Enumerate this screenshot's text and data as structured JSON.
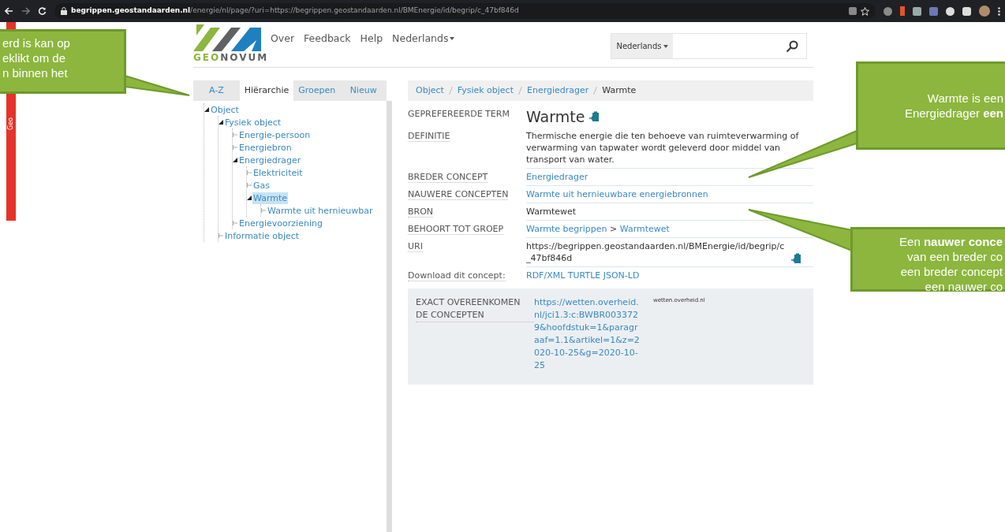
{
  "browser": {
    "url_host": "begrippen.geostandaarden.nl",
    "url_path": "/energie/nl/page/?uri=https://begrippen.geostandaarden.nl/BMEnergie/id/begrip/c_47bf846d"
  },
  "side_strip": {
    "label": "Geo"
  },
  "header": {
    "logo_text_a": "GEO",
    "logo_text_b": "NOVUM",
    "nav": [
      "Over",
      "Feedback",
      "Help"
    ],
    "language": "Nederlands",
    "search": {
      "language": "Nederlands"
    }
  },
  "tabs": [
    {
      "label": "A-Z",
      "selected": false
    },
    {
      "label": "Hiërarchie",
      "selected": true
    },
    {
      "label": "Groepen",
      "selected": false
    },
    {
      "label": "Nieuw",
      "selected": false
    }
  ],
  "tree": [
    {
      "label": "Object",
      "expanded": true,
      "selected": false,
      "children": [
        {
          "label": "Fysiek object",
          "expanded": true,
          "selected": false,
          "children": [
            {
              "label": "Energie-persoon",
              "expanded": false,
              "selected": false
            },
            {
              "label": "Energiebron",
              "expanded": false,
              "selected": false
            },
            {
              "label": "Energiedrager",
              "expanded": true,
              "selected": false,
              "children": [
                {
                  "label": "Elektriciteit",
                  "expanded": false,
                  "selected": false
                },
                {
                  "label": "Gas",
                  "expanded": false,
                  "selected": false
                },
                {
                  "label": "Warmte",
                  "expanded": true,
                  "selected": true,
                  "children": [
                    {
                      "label": "Warmte uit hernieuwbar",
                      "expanded": false,
                      "selected": false
                    }
                  ]
                }
              ]
            },
            {
              "label": "Energievoorziening",
              "expanded": false,
              "selected": false
            }
          ]
        },
        {
          "label": "Informatie object",
          "expanded": false,
          "selected": false
        }
      ]
    }
  ],
  "breadcrumb": [
    {
      "label": "Object",
      "kind": "link"
    },
    {
      "label": "Fysiek object",
      "kind": "link"
    },
    {
      "label": "Energiedrager",
      "kind": "link"
    },
    {
      "label": "Warmte",
      "kind": "current"
    }
  ],
  "details": [
    {
      "label": "GEPREFEREERDE TERM",
      "kind": "title",
      "parts": [
        {
          "text": "Warmte",
          "kind": "text"
        }
      ],
      "copy_icon": true
    },
    {
      "label": "DEFINITIE",
      "kind": "plain",
      "parts": [
        {
          "text": "Thermische energie die ten behoeve van ruimteverwarming of verwarming van tapwater wordt geleverd door middel van transport van water.",
          "kind": "text"
        }
      ],
      "copy_icon": false
    },
    {
      "label": "BREDER CONCEPT",
      "kind": "plain",
      "parts": [
        {
          "text": "Energiedrager",
          "kind": "link"
        }
      ],
      "copy_icon": false
    },
    {
      "label": "NAUWERE CONCEPTEN",
      "kind": "plain",
      "parts": [
        {
          "text": "Warmte uit hernieuwbare energiebronnen",
          "kind": "link"
        }
      ],
      "copy_icon": false
    },
    {
      "label": "BRON",
      "kind": "plain",
      "parts": [
        {
          "text": "Warmtewet",
          "kind": "text"
        }
      ],
      "copy_icon": false
    },
    {
      "label": "BEHOORT TOT GROEP",
      "kind": "plain",
      "parts": [
        {
          "text": "Warmte begrippen",
          "kind": "link"
        },
        {
          "text": ">",
          "kind": "text"
        },
        {
          "text": "Warmtewet",
          "kind": "link"
        }
      ],
      "copy_icon": false
    },
    {
      "label": "URI",
      "kind": "plain",
      "parts": [
        {
          "text": "https://begrippen.geostandaarden.nl/BMEnergie/id/begrip/c_47bf846d",
          "kind": "text"
        }
      ],
      "copy_icon": true
    },
    {
      "label": "Download dit concept:",
      "kind": "plain",
      "parts": [
        {
          "text": "RDF/XML",
          "kind": "link"
        },
        {
          "text": "TURTLE",
          "kind": "link"
        },
        {
          "text": "JSON-LD",
          "kind": "link"
        }
      ],
      "copy_icon": false
    }
  ],
  "exact_match": {
    "label": "EXACT OVEREENKOMEN DE CONCEPTEN",
    "link": "https://wetten.overheid.nl/jci1.3:c:BWBR0033729&hoofdstuk=1&paragraaf=1.1&artikel=1&z=2020-10-25&g=2020-10-25",
    "source": "wetten.overheid.nl"
  },
  "callouts": [
    {
      "lines": [
        "erd is kan op",
        "eklikt om de",
        "n binnen het"
      ]
    },
    {
      "lines": [
        "Warmte is een",
        "Energiedrager **een**"
      ]
    },
    {
      "lines": [
        "Een **nauwer conce**",
        "van een breder co",
        "een breder concept",
        "een nauwer co"
      ]
    }
  ]
}
